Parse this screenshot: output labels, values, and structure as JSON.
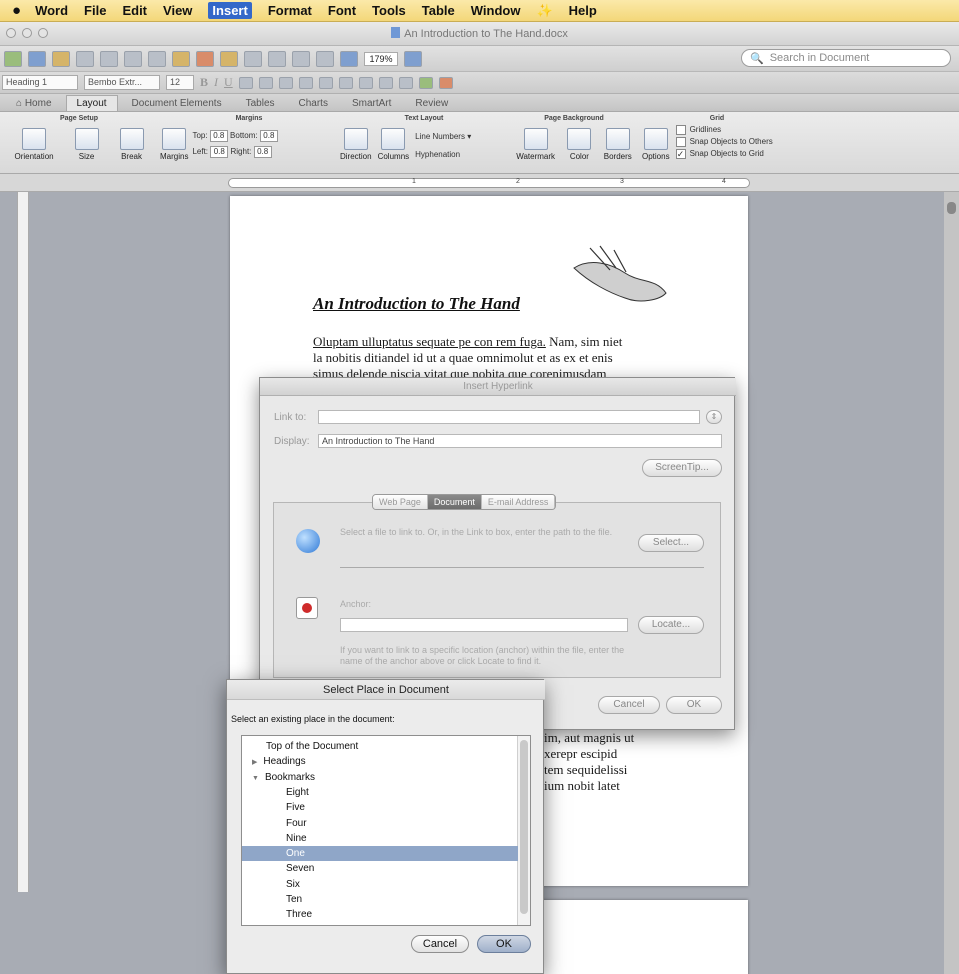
{
  "menubar": {
    "apple": "",
    "items": [
      "Word",
      "File",
      "Edit",
      "View",
      "Insert",
      "Format",
      "Font",
      "Tools",
      "Table",
      "Window",
      "✨",
      "Help"
    ],
    "selected_index": 4
  },
  "window": {
    "title": "An Introduction to The Hand.docx"
  },
  "toolbar": {
    "zoom": "179%",
    "search_placeholder": "Search in Document"
  },
  "formatbar": {
    "style": "Heading 1",
    "font": "Bembo Extr...",
    "size": "12"
  },
  "ribbon_tabs": [
    "Home",
    "Layout",
    "Document Elements",
    "Tables",
    "Charts",
    "SmartArt",
    "Review"
  ],
  "ribbon_active_tab": "Layout",
  "ribbon": {
    "page_setup": {
      "label": "Page Setup",
      "orientation": "Orientation",
      "size": "Size",
      "break": "Break"
    },
    "margins": {
      "label": "Margins",
      "button": "Margins",
      "top_label": "Top:",
      "top": "0.8",
      "bottom_label": "Bottom:",
      "bottom": "0.8",
      "left_label": "Left:",
      "left": "0.8",
      "right_label": "Right:",
      "right": "0.8"
    },
    "text_layout": {
      "label": "Text Layout",
      "direction": "Direction",
      "columns": "Columns",
      "line_numbers": "Line Numbers",
      "hyphenation": "Hyphenation"
    },
    "page_background": {
      "label": "Page Background",
      "watermark": "Watermark",
      "color": "Color",
      "borders": "Borders"
    },
    "grid": {
      "label": "Grid",
      "options": "Options",
      "gridlines": "Gridlines",
      "snap_others": "Snap Objects to Others",
      "snap_grid": "Snap Objects to Grid"
    }
  },
  "ruler": {
    "marks": [
      "1",
      "2",
      "3",
      "4"
    ]
  },
  "document": {
    "title": "An Introduction to The Hand",
    "para1_link": "Oluptam ulluptatus sequate pe con rem fuga.",
    "para1_rest": " Nam, sim niet",
    "para1_line2": "la nobitis ditiandel id ut a quae omnimolut et as ex et enis",
    "para1_line3": "simus delende niscia vitat que nobita que corenimusdam",
    "para2_lines": [
      "im, aut magnis ut",
      "xerepr escipid",
      "tem sequidelissi",
      "ium nobit latet"
    ]
  },
  "hyperlink_dialog": {
    "title": "Insert Hyperlink",
    "link_to_label": "Link to:",
    "link_to_value": "",
    "display_label": "Display:",
    "display_value": "An Introduction to The Hand",
    "screentip": "ScreenTip...",
    "tabs": [
      "Web Page",
      "Document",
      "E-mail Address"
    ],
    "active_tab": "Document",
    "select_hint": "Select a file to link to. Or, in the Link to box, enter the path to the file.",
    "select_button": "Select...",
    "anchor_label": "Anchor:",
    "anchor_value": "",
    "locate_button": "Locate...",
    "anchor_hint": "If you want to link to a specific location (anchor) within the file, enter the name of the anchor above or click Locate to find it.",
    "cancel": "Cancel",
    "ok": "OK"
  },
  "place_dialog": {
    "title": "Select Place in Document",
    "prompt": "Select an existing place in the document:",
    "items": [
      {
        "label": "Top of the Document",
        "indent": 0,
        "arrow": ""
      },
      {
        "label": "Headings",
        "indent": 0,
        "arrow": "▶"
      },
      {
        "label": "Bookmarks",
        "indent": 0,
        "arrow": "▼"
      },
      {
        "label": "Eight",
        "indent": 1,
        "arrow": ""
      },
      {
        "label": "Five",
        "indent": 1,
        "arrow": ""
      },
      {
        "label": "Four",
        "indent": 1,
        "arrow": ""
      },
      {
        "label": "Nine",
        "indent": 1,
        "arrow": ""
      },
      {
        "label": "One",
        "indent": 1,
        "arrow": "",
        "selected": true
      },
      {
        "label": "Seven",
        "indent": 1,
        "arrow": ""
      },
      {
        "label": "Six",
        "indent": 1,
        "arrow": ""
      },
      {
        "label": "Ten",
        "indent": 1,
        "arrow": ""
      },
      {
        "label": "Three",
        "indent": 1,
        "arrow": ""
      }
    ],
    "cancel": "Cancel",
    "ok": "OK"
  }
}
